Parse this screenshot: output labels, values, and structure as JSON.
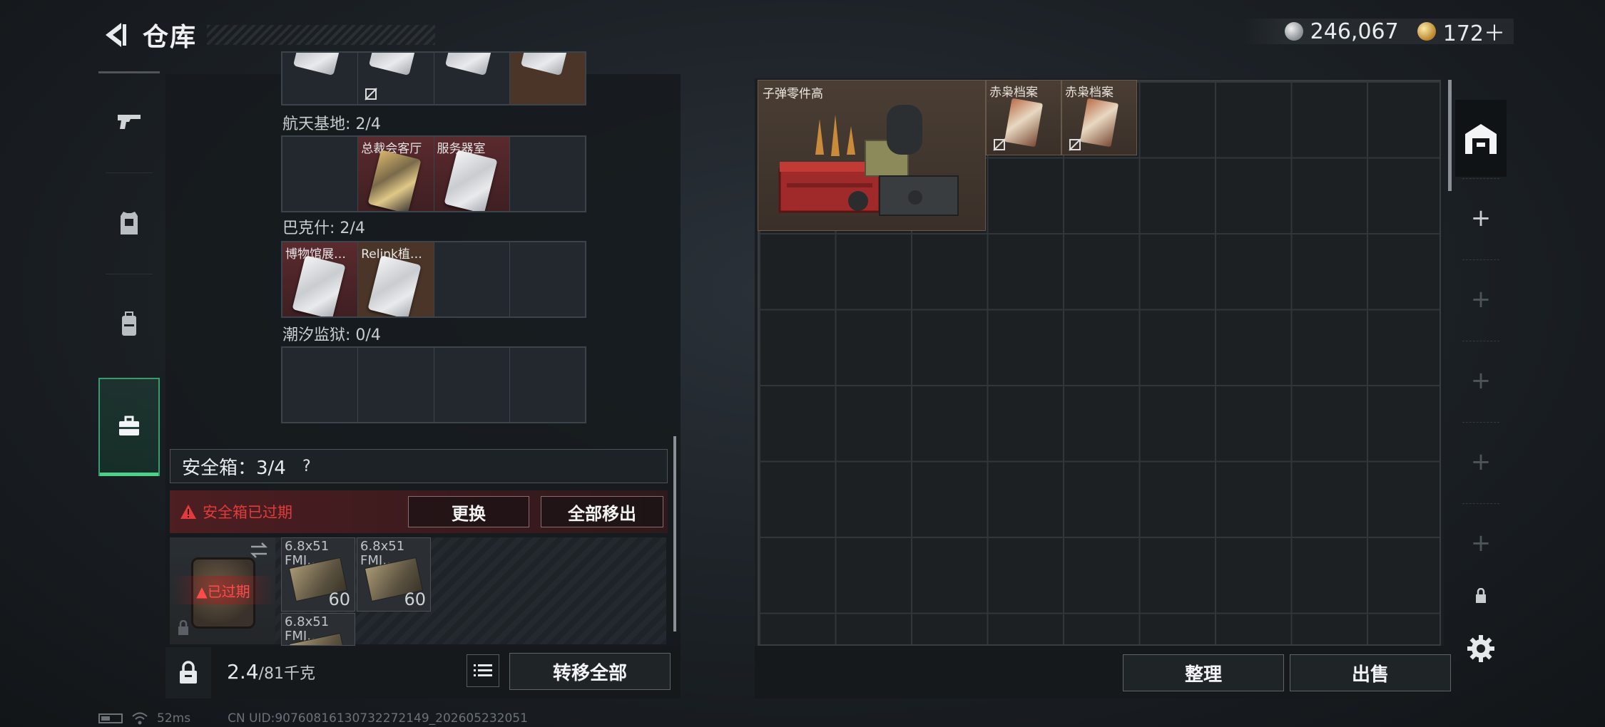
{
  "header": {
    "title": "仓库",
    "silver_amount": "246,067",
    "gold_amount": "172＋"
  },
  "categories": [
    {
      "name": "weapon",
      "icon": "pistol-icon"
    },
    {
      "name": "armor",
      "icon": "vest-icon"
    },
    {
      "name": "backpack",
      "icon": "backpack-icon"
    },
    {
      "name": "case",
      "icon": "toolbox-icon",
      "active": true
    }
  ],
  "keycards": {
    "groups": [
      {
        "label": "航天基地: 2/4",
        "slots": [
          "",
          "总裁会客厅",
          "服务器室",
          ""
        ]
      },
      {
        "label": "巴克什: 2/4",
        "slots": [
          "博物馆展…",
          "Relink植…",
          "",
          ""
        ]
      },
      {
        "label": "潮汐监狱: 0/4",
        "slots": [
          "",
          "",
          "",
          ""
        ]
      }
    ]
  },
  "safe": {
    "title": "安全箱：3/4",
    "help": "?",
    "expired_warning": "安全箱已过期",
    "replace_label": "更换",
    "remove_all_label": "全部移出",
    "case_expired_label": "已过期",
    "items": [
      {
        "name": "6.8x51 FMJ…",
        "count": "60"
      },
      {
        "name": "6.8x51 FMJ…",
        "count": "60"
      },
      {
        "name": "6.8x51 FMJ…",
        "count": ""
      }
    ]
  },
  "footer_left": {
    "weight_current": "2.4",
    "weight_max": "/81千克",
    "transfer_all_label": "转移全部"
  },
  "stash": {
    "items": [
      {
        "name": "子弹零件高"
      },
      {
        "name": "赤枭档案"
      },
      {
        "name": "赤枭档案"
      }
    ],
    "sort_label": "整理",
    "sell_label": "出售"
  },
  "status": {
    "ping": "52ms",
    "uid": "CN UID:9076081613073227214​9_202605232051"
  },
  "colors": {
    "accent_green": "#4cd18a",
    "warning_red": "#e23b3b",
    "expired_bg": "#4d1e22"
  }
}
